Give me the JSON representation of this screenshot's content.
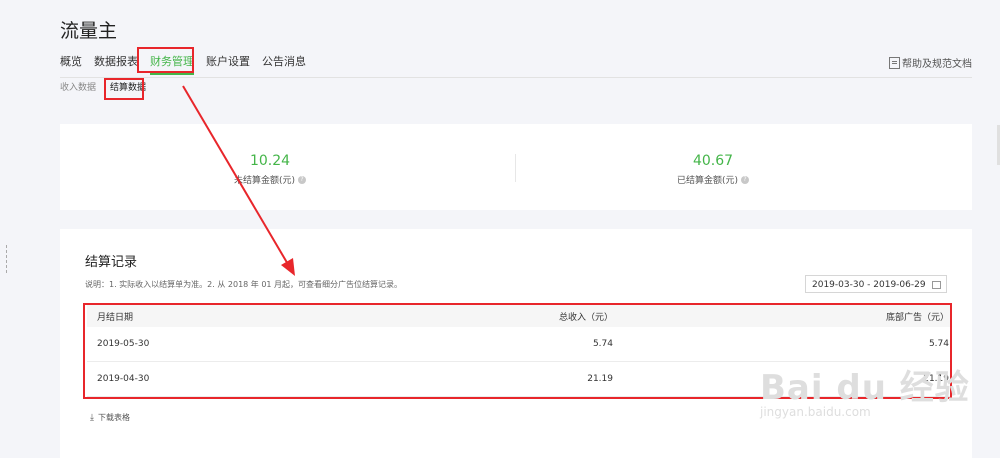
{
  "app_title": "流量主",
  "nav": [
    "概览",
    "数据报表",
    "财务管理",
    "账户设置",
    "公告消息"
  ],
  "help_label": "帮助及规范文档",
  "subnav": [
    "收入数据",
    "结算数据"
  ],
  "stats": {
    "unsettled_value": "10.24",
    "unsettled_label": "未结算金额(元)",
    "settled_value": "40.67",
    "settled_label": "已结算金额(元)"
  },
  "section": {
    "title": "结算记录",
    "note": "说明：1. 实际收入以结算单为准。2. 从 2018 年 01 月起，可查看细分广告位结算记录。",
    "date_range": "2019-03-30 - 2019-06-29"
  },
  "table": {
    "headers": [
      "月结日期",
      "总收入（元）",
      "底部广告（元）"
    ],
    "rows": [
      [
        "2019-05-30",
        "5.74",
        "5.74"
      ],
      [
        "2019-04-30",
        "21.19",
        "21.19"
      ]
    ]
  },
  "download_label": "下载表格",
  "watermark": {
    "logo": "Bai du 经验",
    "url": "jingyan.baidu.com"
  },
  "colors": {
    "accent": "#44b549",
    "annotation": "#e8262b"
  },
  "icons": [
    "doc-icon",
    "question-icon",
    "calendar-icon",
    "download-icon"
  ]
}
